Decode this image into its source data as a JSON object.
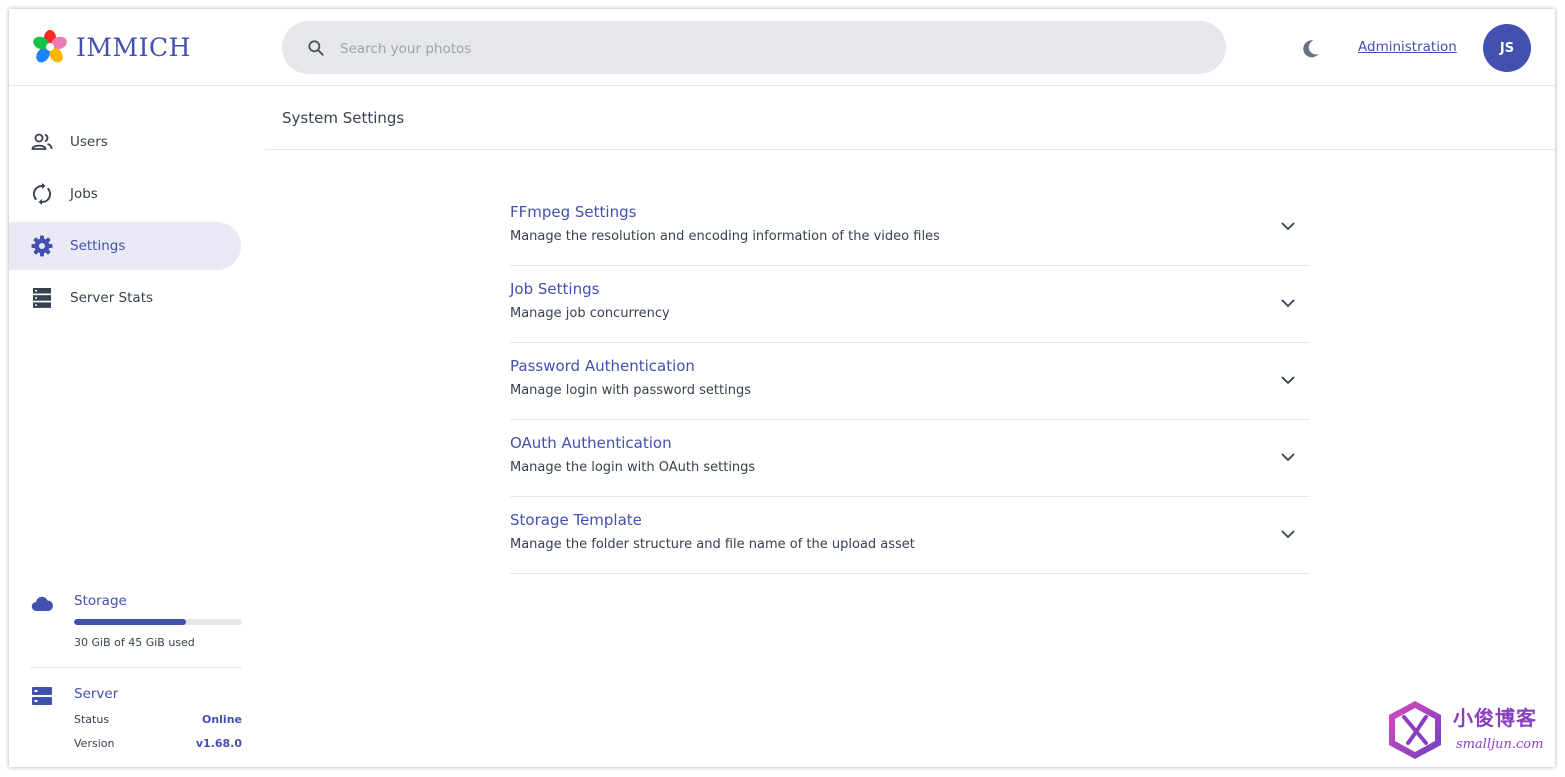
{
  "app": {
    "name": "IMMICH"
  },
  "search": {
    "placeholder": "Search your photos"
  },
  "header": {
    "admin_link": "Administration",
    "avatar_initials": "JS",
    "theme_icon": "moon-icon"
  },
  "sidebar": {
    "items": [
      {
        "label": "Users",
        "icon": "users-icon",
        "active": false
      },
      {
        "label": "Jobs",
        "icon": "sync-icon",
        "active": false
      },
      {
        "label": "Settings",
        "icon": "gear-icon",
        "active": true
      },
      {
        "label": "Server Stats",
        "icon": "server-stack-icon",
        "active": false
      }
    ],
    "storage": {
      "title": "Storage",
      "used_text": "30 GiB of 45 GiB used",
      "used_fraction": 0.667
    },
    "server": {
      "title": "Server",
      "status_label": "Status",
      "status_value": "Online",
      "version_label": "Version",
      "version_value": "v1.68.0"
    }
  },
  "main": {
    "title": "System Settings",
    "sections": [
      {
        "title": "FFmpeg Settings",
        "description": "Manage the resolution and encoding information of the video files"
      },
      {
        "title": "Job Settings",
        "description": "Manage job concurrency"
      },
      {
        "title": "Password Authentication",
        "description": "Manage login with password settings"
      },
      {
        "title": "OAuth Authentication",
        "description": "Manage the login with OAuth settings"
      },
      {
        "title": "Storage Template",
        "description": "Manage the folder structure and file name of the upload asset"
      }
    ]
  },
  "watermark": {
    "title": "小俊博客",
    "subtitle": "smalljun.com"
  },
  "colors": {
    "accent": "#4250af",
    "active_bg": "#e8e9f5",
    "search_bg": "#e5e7eb",
    "text": "#374151",
    "watermark": "#8b3fc0"
  }
}
